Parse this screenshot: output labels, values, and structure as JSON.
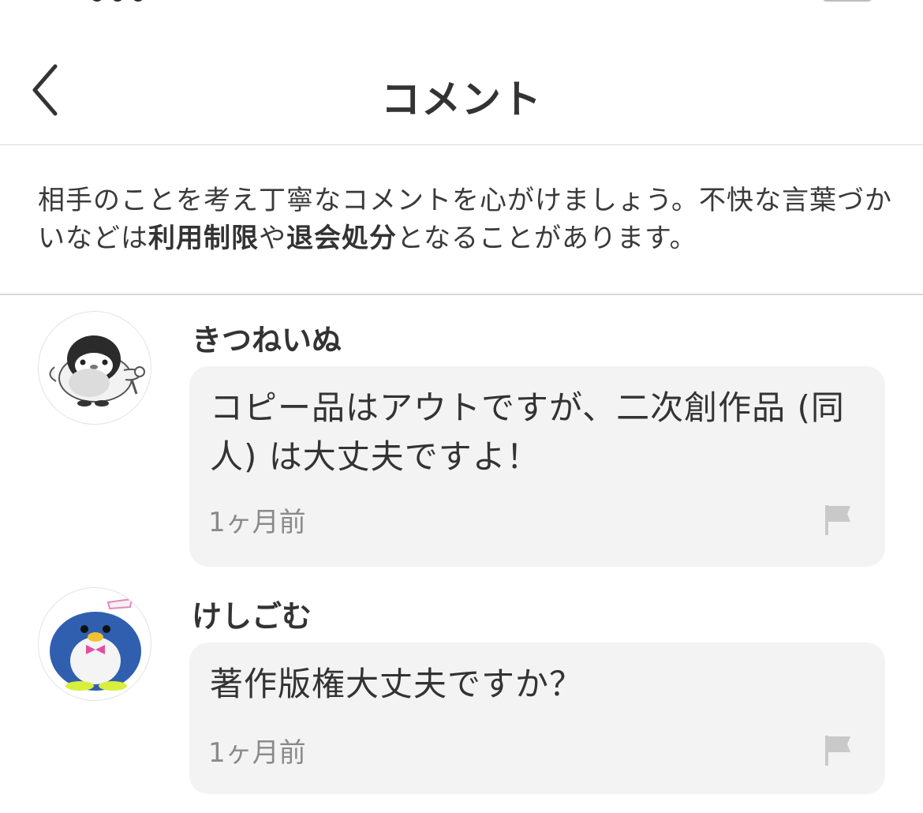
{
  "header": {
    "title": "コメント",
    "back_icon": "chevron-left-icon"
  },
  "notice": {
    "part1": "相手のことを考え丁寧なコメントを心がけましょう。不快な言葉づかいなどは",
    "bold1": "利用制限",
    "part2": "や",
    "bold2": "退会処分",
    "part3": "となることがあります。"
  },
  "comments": [
    {
      "username": "きつねいぬ",
      "text": "コピー品はアウトですが、二次創作品 (同人) は大丈夫ですよ！",
      "time": "1ヶ月前",
      "avatar_icon": "penguin-avatar-icon",
      "flag_icon": "flag-icon"
    },
    {
      "username": "けしごむ",
      "text": "著作版権大丈夫ですか？",
      "time": "1ヶ月前",
      "avatar_icon": "blue-penguin-plush-avatar-icon",
      "flag_icon": "flag-icon"
    }
  ],
  "colors": {
    "bubble": "#f3f3f3",
    "divider": "#d8d8d8",
    "text": "#333333",
    "muted": "#8a8a8a"
  }
}
